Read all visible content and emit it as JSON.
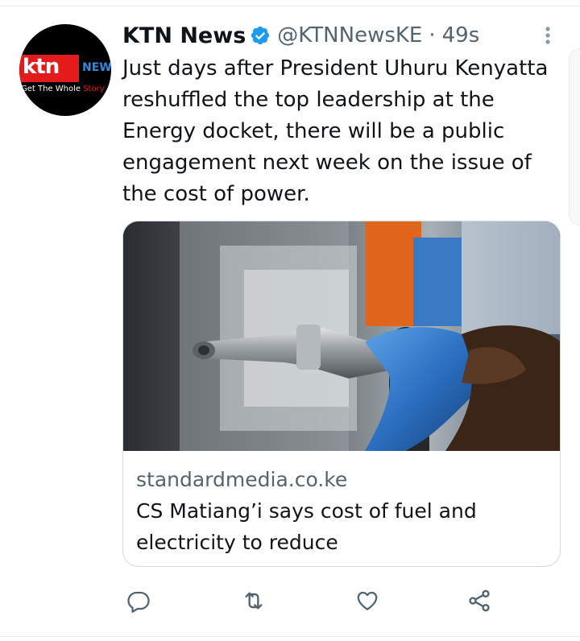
{
  "avatar": {
    "logo_main": "ktn",
    "logo_news": "NEWS",
    "tagline_white": "Get The Whole ",
    "tagline_red": "Story"
  },
  "tweet": {
    "display_name": "KTN News",
    "handle": "@KTNNewsKE",
    "separator": "·",
    "time": "49s",
    "text": "Just days after President Uhuru Kenyatta reshuffled the top leadership at the Energy docket, there will be a public engagement next week on the issue of the cost of power."
  },
  "card": {
    "domain": "standardmedia.co.ke",
    "title": "CS Matiang’i says cost of fuel and electricity to reduce"
  },
  "icons": {
    "verified": "verified-badge-icon",
    "more": "more-options-icon",
    "reply": "reply-icon",
    "retweet": "retweet-icon",
    "like": "like-icon",
    "share": "share-icon"
  },
  "colors": {
    "verified": "#1d9bf0",
    "secondary_text": "#536471",
    "primary_text": "#0f1419",
    "border": "#cfd9de"
  }
}
